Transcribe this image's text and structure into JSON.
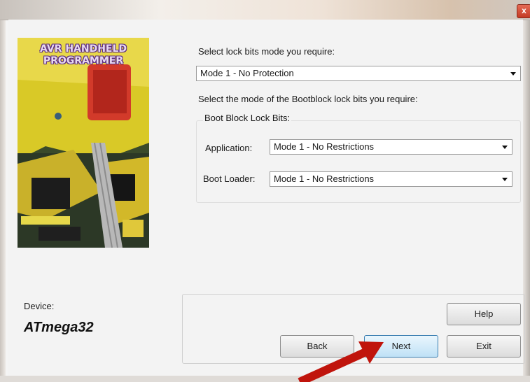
{
  "window": {
    "close_glyph": "x"
  },
  "image": {
    "logo_line1": "AVR HANDHELD",
    "logo_line2": "PROGRAMMER"
  },
  "lock_bits": {
    "prompt": "Select lock bits mode you require:",
    "selected": "Mode 1 - No Protection"
  },
  "bootblock": {
    "prompt": "Select the mode of the Bootblock lock bits you require:",
    "group_title": "Boot Block Lock Bits:",
    "application_label": "Application:",
    "application_selected": "Mode 1 - No Restrictions",
    "boot_loader_label": "Boot Loader:",
    "boot_loader_selected": "Mode 1 - No Restrictions"
  },
  "device": {
    "label": "Device:",
    "name": "ATmega32"
  },
  "buttons": {
    "help": "Help",
    "back": "Back",
    "next": "Next",
    "exit": "Exit"
  },
  "colors": {
    "annotation_arrow": "#c0140c",
    "logo_text": "#e8d9f0",
    "logo_outline": "#5a2a82",
    "focus_border": "#3c7fb1"
  }
}
